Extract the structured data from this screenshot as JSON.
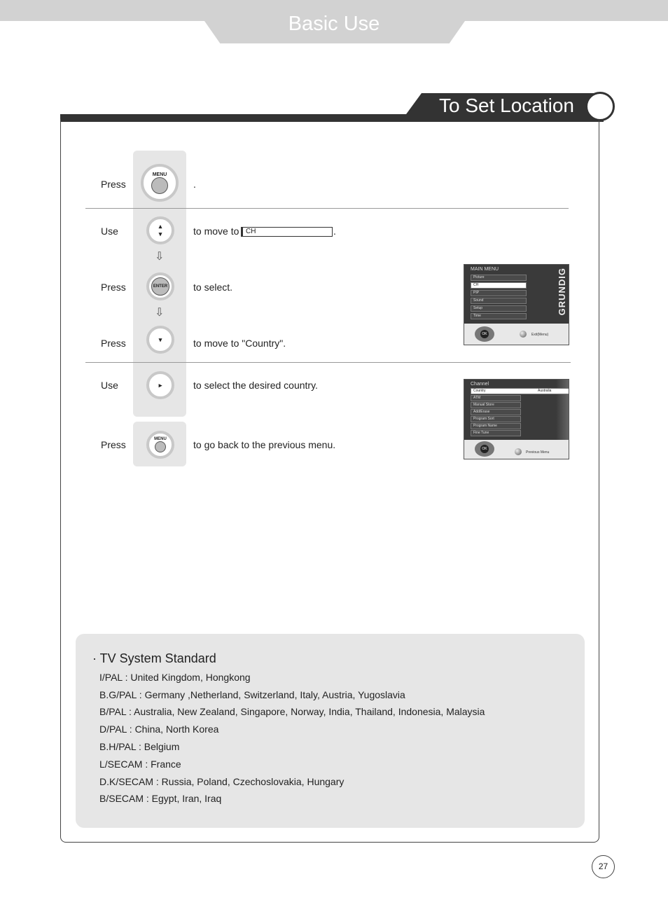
{
  "header": {
    "section": "Basic Use",
    "title": "To Set Location"
  },
  "steps": [
    {
      "verb": "Press",
      "button": "MENU",
      "text": "."
    },
    {
      "verb": "Use",
      "button": "CH up/down",
      "text": "to move to",
      "field": "CH",
      "after": "."
    },
    {
      "verb": "Press",
      "button": "ENTER",
      "text": "to select."
    },
    {
      "verb": "Press",
      "button": "CH down",
      "text": "to move to \"Country\"."
    },
    {
      "verb": "Use",
      "button": "VOL",
      "text": "to select the desired country."
    },
    {
      "verb": "Press",
      "button": "MENU",
      "text": "to go back to the previous menu."
    }
  ],
  "screen1": {
    "title": "MAIN MENU",
    "items": [
      "Picture",
      "CH",
      "PIP",
      "Sound",
      "Setup",
      "Time"
    ],
    "selected": "CH",
    "brand": "GRUNDIG",
    "ok": "OK",
    "footer": "Exit(Menu)"
  },
  "screen2": {
    "title": "Channel",
    "items": [
      "Country",
      "ATM",
      "Manual Store",
      "Add/Erase",
      "Program Sort",
      "Program Name",
      "Fine Tune"
    ],
    "country_value": "Australia",
    "ok": "OK",
    "footer": "Previous Menu"
  },
  "note": {
    "heading": "· TV System Standard",
    "lines": [
      "I/PAL : United Kingdom, Hongkong",
      "B.G/PAL : Germany ,Netherland, Switzerland, Italy, Austria, Yugoslavia",
      "B/PAL : Australia, New Zealand, Singapore,  Norway, India, Thailand, Indonesia, Malaysia",
      "D/PAL : China,  North Korea",
      "B.H/PAL : Belgium",
      "L/SECAM : France",
      "D.K/SECAM : Russia, Poland, Czechoslovakia, Hungary",
      "B/SECAM : Egypt,  Iran, Iraq"
    ]
  },
  "page_number": "27"
}
